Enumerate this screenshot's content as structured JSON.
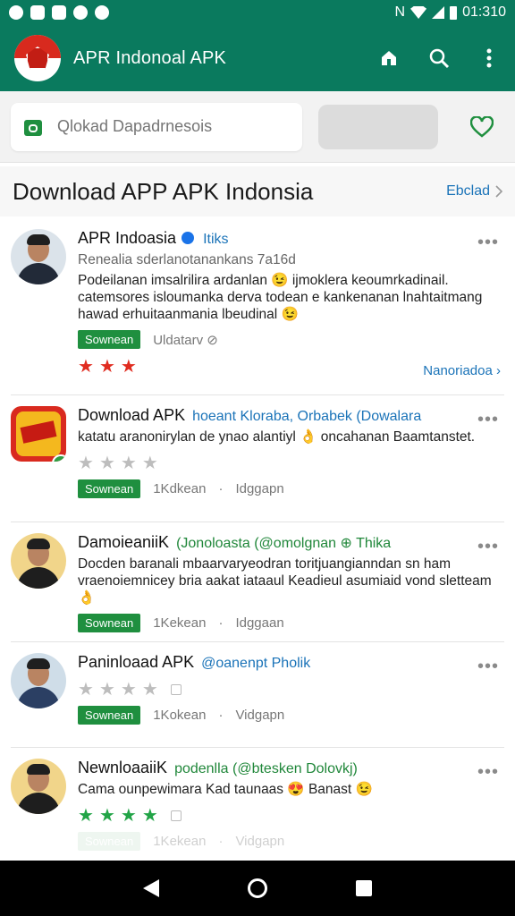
{
  "statusbar": {
    "time": "01:310",
    "network": "N"
  },
  "appbar": {
    "title": "APR Indonoal APK",
    "icons": [
      "home-icon",
      "search-icon",
      "more-vert-icon"
    ]
  },
  "search": {
    "placeholder": "Qlokad Dapadrnesois",
    "icon": "app-store-icon"
  },
  "section": {
    "title": "Download APP APK Indonsia",
    "link": "Ebclad"
  },
  "items": [
    {
      "title": "APR Indoasia",
      "subtitle": "Itiks",
      "desc_gray": "Renealia sderlanotanankans 7a16d",
      "desc": "Podeilanan imsalrilira ardanlan 😉 ijmoklera keoumrkadinail. catemsores isloumanka derva todean e kankenanan lnahtaitmang hawad erhuitaanmania lbeudinal 😉",
      "tag": "Sownean",
      "meta": [
        "Uldatarv ⊘"
      ],
      "stars": 3,
      "star_color": "#e02c20",
      "right_link": "Nanoriadoa"
    },
    {
      "title": "Download APK",
      "subtitle": "hoeant Kloraba, Orbabek (Dowalara",
      "desc": "katatu aranonirylan de ynao alantiyl 👌 oncahanan Baamtanstet.",
      "tag": "Sownean",
      "meta": [
        "1Kdkean",
        "·",
        "Idggapn"
      ],
      "stars": 4,
      "star_color": "#bdbdbd"
    },
    {
      "title": "DamoieaniiK",
      "subtitle": "(Jonoloasta (@omolgnan ⊕ Thika",
      "desc": "Docden baranali mbaarvaryeodran toritjuangianndan sn ham vraenoiemnicey bria aakat iataaul Keadieul asumiaid vond sletteam 👌",
      "tag": "Sownean",
      "meta": [
        "1Kekean",
        "·",
        "Idggaan"
      ],
      "stars": 0,
      "star_color": "#bdbdbd"
    },
    {
      "title": "Paninloaad APK",
      "subtitle": "@oanenpt Pholik",
      "desc": "",
      "tag": "Sownean",
      "meta": [
        "1Kokean",
        "·",
        "Vidgapn"
      ],
      "stars": 4,
      "star_color": "#bdbdbd"
    },
    {
      "title": "NewnloaaiiK",
      "subtitle": "podenlla (@btesken Dolovkj)",
      "desc": "Cama ounpewimara Kad taunaas 😍 Banast 😉",
      "tag": "Sownean",
      "meta": [
        "1Kekean",
        "·",
        "Vidgapn"
      ],
      "stars": 4,
      "star_color": "#22a447"
    }
  ],
  "navbar": {
    "icons": [
      "back-icon",
      "home-circle-icon",
      "recents-icon"
    ]
  },
  "colors": {
    "primary": "#0a7a5e",
    "accent_link": "#1a73b8",
    "tag_green": "#1f8f3f"
  }
}
